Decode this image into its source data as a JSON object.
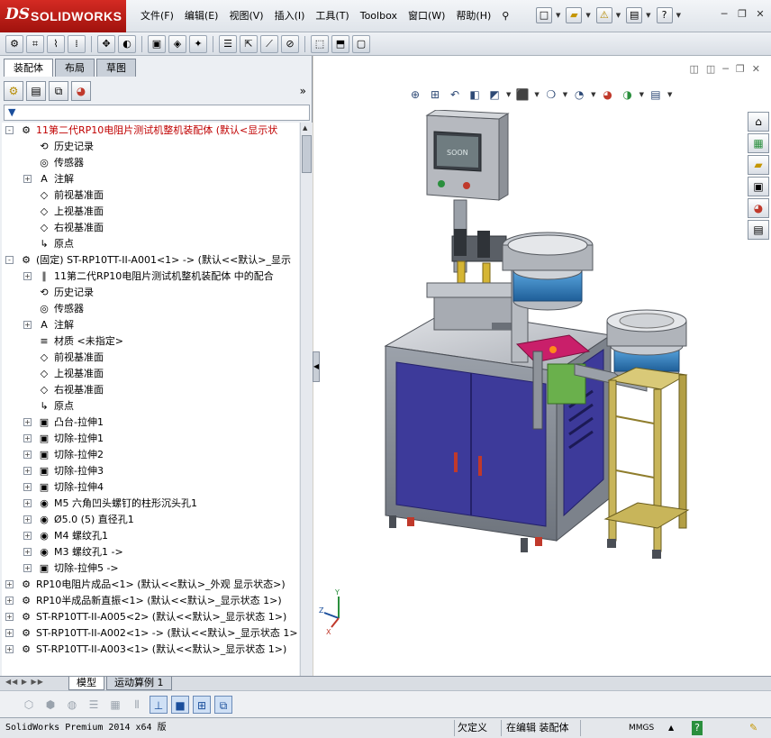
{
  "app": {
    "brand": "SOLIDWORKS",
    "ds_mark": "DS"
  },
  "menu": {
    "items": [
      "文件(F)",
      "编辑(E)",
      "视图(V)",
      "插入(I)",
      "工具(T)",
      "Toolbox",
      "窗口(W)",
      "帮助(H)"
    ]
  },
  "panel": {
    "tabs": [
      "装配体",
      "布局",
      "草图"
    ],
    "active_tab": "装配体",
    "expand_glyph": "»"
  },
  "tree": {
    "rows": [
      {
        "indent": 0,
        "expand": "-",
        "icon": "assembly-icon",
        "glyph": "⚙",
        "label": "11第二代RP10电阻片测试机整机装配体  (默认<显示状",
        "red": true
      },
      {
        "indent": 1,
        "expand": "",
        "icon": "history-icon",
        "glyph": "⟲",
        "label": "历史记录"
      },
      {
        "indent": 1,
        "expand": "",
        "icon": "sensor-icon",
        "glyph": "◎",
        "label": "传感器"
      },
      {
        "indent": 1,
        "expand": "+",
        "icon": "annotation-icon",
        "glyph": "A",
        "label": "注解"
      },
      {
        "indent": 1,
        "expand": "",
        "icon": "plane-icon",
        "glyph": "◇",
        "label": "前视基准面"
      },
      {
        "indent": 1,
        "expand": "",
        "icon": "plane-icon",
        "glyph": "◇",
        "label": "上视基准面"
      },
      {
        "indent": 1,
        "expand": "",
        "icon": "plane-icon",
        "glyph": "◇",
        "label": "右视基准面"
      },
      {
        "indent": 1,
        "expand": "",
        "icon": "origin-icon",
        "glyph": "↳",
        "label": "原点"
      },
      {
        "indent": 0,
        "expand": "-",
        "icon": "part-icon",
        "glyph": "⚙",
        "label": "(固定) ST-RP10TT-II-A001<1> -> (默认<<默认>_显示"
      },
      {
        "indent": 1,
        "expand": "+",
        "icon": "mates-icon",
        "glyph": "∥",
        "label": "11第二代RP10电阻片测试机整机装配体 中的配合"
      },
      {
        "indent": 1,
        "expand": "",
        "icon": "history-icon",
        "glyph": "⟲",
        "label": "历史记录"
      },
      {
        "indent": 1,
        "expand": "",
        "icon": "sensor-icon",
        "glyph": "◎",
        "label": "传感器"
      },
      {
        "indent": 1,
        "expand": "+",
        "icon": "annotation-icon",
        "glyph": "A",
        "label": "注解"
      },
      {
        "indent": 1,
        "expand": "",
        "icon": "material-icon",
        "glyph": "≡",
        "label": "材质 <未指定>"
      },
      {
        "indent": 1,
        "expand": "",
        "icon": "plane-icon",
        "glyph": "◇",
        "label": "前视基准面"
      },
      {
        "indent": 1,
        "expand": "",
        "icon": "plane-icon",
        "glyph": "◇",
        "label": "上视基准面"
      },
      {
        "indent": 1,
        "expand": "",
        "icon": "plane-icon",
        "glyph": "◇",
        "label": "右视基准面"
      },
      {
        "indent": 1,
        "expand": "",
        "icon": "origin-icon",
        "glyph": "↳",
        "label": "原点"
      },
      {
        "indent": 1,
        "expand": "+",
        "icon": "boss-extrude-icon",
        "glyph": "▣",
        "label": "凸台-拉伸1"
      },
      {
        "indent": 1,
        "expand": "+",
        "icon": "cut-extrude-icon",
        "glyph": "▣",
        "label": "切除-拉伸1"
      },
      {
        "indent": 1,
        "expand": "+",
        "icon": "cut-extrude-icon",
        "glyph": "▣",
        "label": "切除-拉伸2"
      },
      {
        "indent": 1,
        "expand": "+",
        "icon": "cut-extrude-icon",
        "glyph": "▣",
        "label": "切除-拉伸3"
      },
      {
        "indent": 1,
        "expand": "+",
        "icon": "cut-extrude-icon",
        "glyph": "▣",
        "label": "切除-拉伸4"
      },
      {
        "indent": 1,
        "expand": "+",
        "icon": "hole-icon",
        "glyph": "◉",
        "label": "M5 六角凹头螺钉的柱形沉头孔1"
      },
      {
        "indent": 1,
        "expand": "+",
        "icon": "hole-icon",
        "glyph": "◉",
        "label": "Ø5.0 (5) 直径孔1"
      },
      {
        "indent": 1,
        "expand": "+",
        "icon": "hole-icon",
        "glyph": "◉",
        "label": "M4 螺纹孔1"
      },
      {
        "indent": 1,
        "expand": "+",
        "icon": "hole-icon",
        "glyph": "◉",
        "label": "M3 螺纹孔1 ->"
      },
      {
        "indent": 1,
        "expand": "+",
        "icon": "cut-extrude-icon",
        "glyph": "▣",
        "label": "切除-拉伸5 ->"
      },
      {
        "indent": 0,
        "expand": "+",
        "icon": "part-icon",
        "glyph": "⚙",
        "label": "RP10电阻片成品<1> (默认<<默认>_外观 显示状态>)"
      },
      {
        "indent": 0,
        "expand": "+",
        "icon": "part-icon",
        "glyph": "⚙",
        "label": "RP10半成品新直振<1> (默认<<默认>_显示状态 1>)"
      },
      {
        "indent": 0,
        "expand": "+",
        "icon": "part-icon",
        "glyph": "⚙",
        "label": "ST-RP10TT-II-A005<2> (默认<<默认>_显示状态 1>)"
      },
      {
        "indent": 0,
        "expand": "+",
        "icon": "part-icon",
        "glyph": "⚙",
        "label": "ST-RP10TT-II-A002<1> -> (默认<<默认>_显示状态 1>"
      },
      {
        "indent": 0,
        "expand": "+",
        "icon": "part-icon",
        "glyph": "⚙",
        "label": "ST-RP10TT-II-A003<1> (默认<<默认>_显示状态 1>)"
      }
    ]
  },
  "viewport": {
    "hmi_screen_text": "SOON",
    "triad": {
      "y": "Y",
      "z": "Z",
      "x": "X"
    }
  },
  "bottom_tabs": [
    "模型",
    "运动算例 1"
  ],
  "status": {
    "product": "SolidWorks Premium 2014 x64 版",
    "definition": "欠定义",
    "mode": "在编辑 装配体",
    "units": "MMGS",
    "help": "?"
  },
  "colors": {
    "accent_red": "#c00000",
    "cabinet_blue": "#3d3a9a",
    "frame_yellow": "#c8b55a",
    "bowl_blue": "#2f7fc0"
  }
}
